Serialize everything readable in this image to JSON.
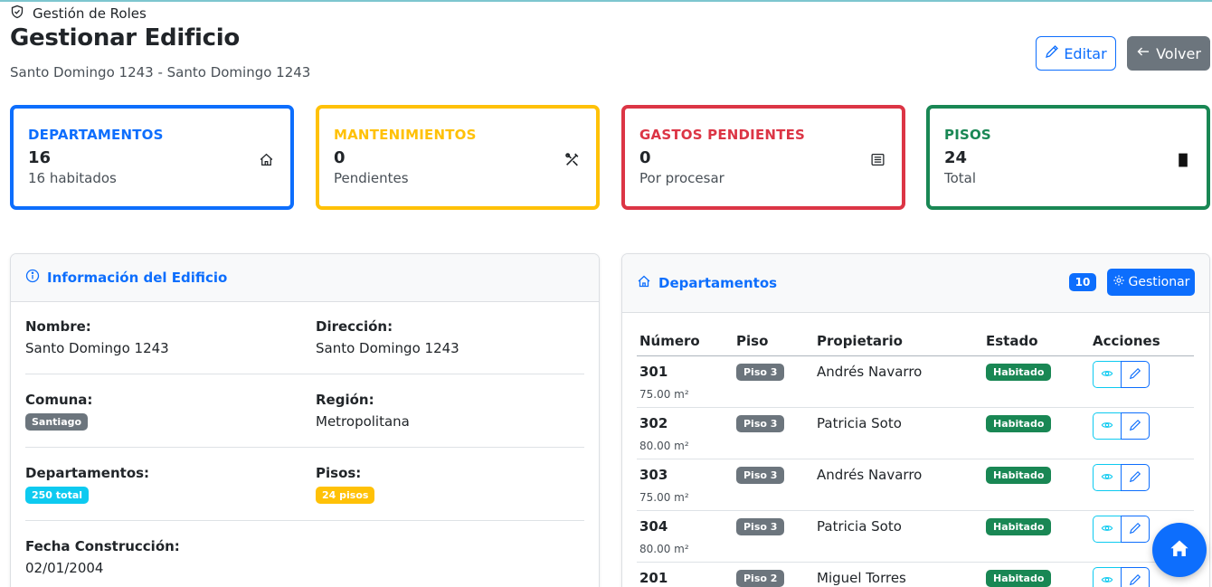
{
  "header": {
    "breadcrumb": "Gestión de Roles",
    "title": "Gestionar Edificio",
    "subtitle": "Santo Domingo 1243 - Santo Domingo 1243",
    "edit_label": "Editar",
    "back_label": "Volver"
  },
  "stats": [
    {
      "label": "DEPARTAMENTOS",
      "value": "16",
      "sub": "16 habitados",
      "color": "#0d6efd",
      "icon": "house-icon"
    },
    {
      "label": "MANTENIMIENTOS",
      "value": "0",
      "sub": "Pendientes",
      "color": "#ffc107",
      "icon": "tools-icon"
    },
    {
      "label": "GASTOS PENDIENTES",
      "value": "0",
      "sub": "Por procesar",
      "color": "#dc3545",
      "icon": "receipt-icon"
    },
    {
      "label": "PISOS",
      "value": "24",
      "sub": "Total",
      "color": "#198754",
      "icon": "building-icon"
    }
  ],
  "info": {
    "title": "Información del Edificio",
    "nombre_label": "Nombre:",
    "nombre": "Santo Domingo 1243",
    "direccion_label": "Dirección:",
    "direccion": "Santo Domingo 1243",
    "comuna_label": "Comuna:",
    "comuna": "Santiago",
    "region_label": "Región:",
    "region": "Metropolitana",
    "departamentos_label": "Departamentos:",
    "departamentos": "250 total",
    "pisos_label": "Pisos:",
    "pisos": "24 pisos",
    "fecha_label": "Fecha Construcción:",
    "fecha": "02/01/2004"
  },
  "departamentos": {
    "title": "Departamentos",
    "count": "10",
    "manage_label": "Gestionar",
    "columns": [
      "Número",
      "Piso",
      "Propietario",
      "Estado",
      "Acciones"
    ],
    "rows": [
      {
        "numero": "301",
        "area": "75.00 m²",
        "piso": "Piso 3",
        "propietario": "Andrés Navarro",
        "estado": "Habitado"
      },
      {
        "numero": "302",
        "area": "80.00 m²",
        "piso": "Piso 3",
        "propietario": "Patricia Soto",
        "estado": "Habitado"
      },
      {
        "numero": "303",
        "area": "75.00 m²",
        "piso": "Piso 3",
        "propietario": "Andrés Navarro",
        "estado": "Habitado"
      },
      {
        "numero": "304",
        "area": "80.00 m²",
        "piso": "Piso 3",
        "propietario": "Patricia Soto",
        "estado": "Habitado"
      },
      {
        "numero": "201",
        "area": "",
        "piso": "Piso 2",
        "propietario": "Miguel Torres",
        "estado": "Habitado"
      }
    ]
  }
}
